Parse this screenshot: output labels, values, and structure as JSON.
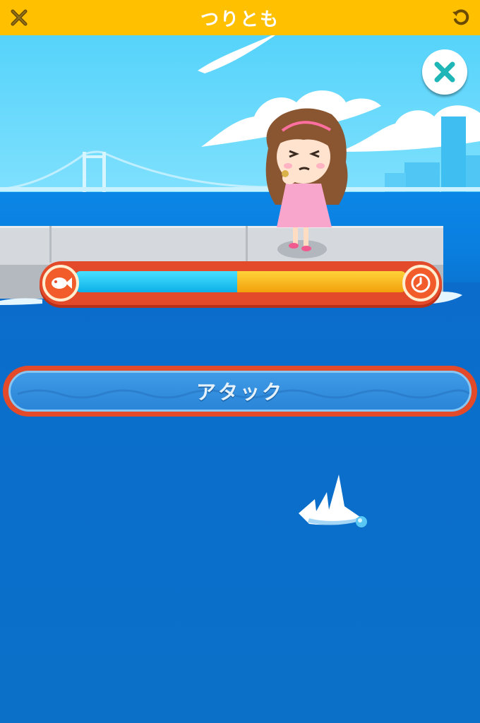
{
  "header": {
    "title": "つりとも",
    "close_icon": "close-icon",
    "reload_icon": "reload-icon",
    "bg_color": "#ffc000"
  },
  "game": {
    "attack_label": "アタック",
    "tension": {
      "blue_fraction": 0.49,
      "orange_fraction": 0.51,
      "left_icon": "fish-icon",
      "right_icon": "clock-icon"
    },
    "overlay_close_icon": "close-icon"
  },
  "colors": {
    "sea": "#0a6fc7",
    "sky": "#56d3fb",
    "gauge_frame": "#e24a29"
  }
}
